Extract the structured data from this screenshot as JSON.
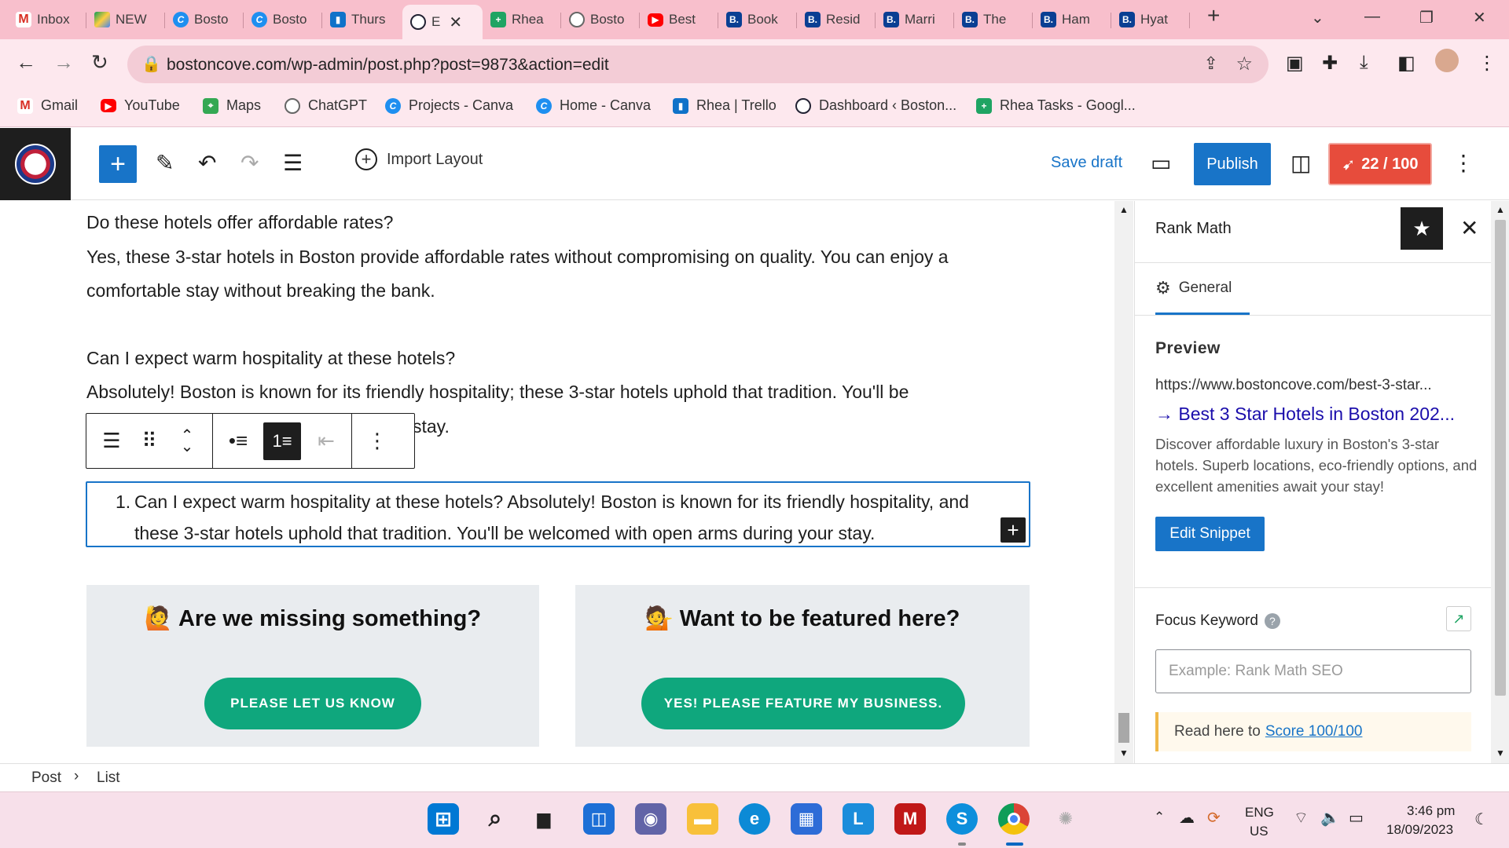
{
  "browser": {
    "tabs": [
      {
        "icon": "gmail-icon",
        "label": "Inbox"
      },
      {
        "icon": "drive-icon",
        "label": "NEW"
      },
      {
        "icon": "canva-icon",
        "label": "Bosto"
      },
      {
        "icon": "canva-icon",
        "label": "Bosto"
      },
      {
        "icon": "trello-icon",
        "label": "Thurs"
      },
      {
        "icon": "bostoncove-icon",
        "label": "E"
      },
      {
        "icon": "sheets-icon",
        "label": "Rhea"
      },
      {
        "icon": "chatgpt-icon",
        "label": "Bosto"
      },
      {
        "icon": "youtube-icon",
        "label": "Best"
      },
      {
        "icon": "booking-icon",
        "label": "Book"
      },
      {
        "icon": "booking-icon",
        "label": "Resid"
      },
      {
        "icon": "booking-icon",
        "label": "Marri"
      },
      {
        "icon": "booking-icon",
        "label": "The"
      },
      {
        "icon": "booking-icon",
        "label": "Ham"
      },
      {
        "icon": "booking-icon",
        "label": "Hyat"
      }
    ],
    "url": "bostoncove.com/wp-admin/post.php?post=9873&action=edit",
    "bookmarks": [
      {
        "icon": "gmail-icon",
        "label": "Gmail"
      },
      {
        "icon": "youtube-icon",
        "label": "YouTube"
      },
      {
        "icon": "maps-icon",
        "label": "Maps"
      },
      {
        "icon": "chatgpt-icon",
        "label": "ChatGPT"
      },
      {
        "icon": "canva-icon",
        "label": "Projects - Canva"
      },
      {
        "icon": "canva-icon",
        "label": "Home - Canva"
      },
      {
        "icon": "trello-icon",
        "label": "Rhea | Trello"
      },
      {
        "icon": "bostoncove-icon",
        "label": "Dashboard ‹ Boston..."
      },
      {
        "icon": "sheets-icon",
        "label": "Rhea Tasks - Googl..."
      }
    ]
  },
  "editor_header": {
    "import_layout": "Import Layout",
    "save_draft": "Save draft",
    "publish": "Publish",
    "seo_score": "22 / 100"
  },
  "content": {
    "q1": "Do these hotels offer affordable rates?",
    "a1_line1": "Yes, these 3-star hotels in Boston provide affordable rates without compromising on quality. You can enjoy a",
    "a1_line2": "comfortable stay without breaking the bank.",
    "q2": "Can I expect warm hospitality at these hotels?",
    "a2_line1": "Absolutely! Boston is known for its friendly hospitality; these 3-star hotels uphold that tradition. You'll be",
    "a2_tail": "stay.",
    "list_number": "1.",
    "list_item": "Can I expect warm hospitality at these hotels? Absolutely! Boston is known for its friendly hospitality, and these 3-star hotels uphold that tradition. You'll be welcomed with open arms during your stay.",
    "cta_left_title": "Are we missing something?",
    "cta_left_emoji": "🙋",
    "cta_left_button": "PLEASE LET US KNOW",
    "cta_right_title": "Want to be featured here?",
    "cta_right_emoji": "💁",
    "cta_right_button": "YES! PLEASE FEATURE MY BUSINESS."
  },
  "sidebar": {
    "title": "Rank Math",
    "tab_general": "General",
    "preview_label": "Preview",
    "snippet_url": "https://www.bostoncove.com/best-3-star...",
    "snippet_title": "→ Best 3 Star Hotels in Boston 202...",
    "snippet_desc": "Discover affordable luxury in Boston's 3-star hotels. Superb locations, eco-friendly options, and excellent amenities await your stay!",
    "edit_snippet": "Edit Snippet",
    "focus_keyword_label": "Focus Keyword",
    "focus_keyword_placeholder": "Example: Rank Math SEO",
    "score_tip_prefix": "Read here to",
    "score_tip_link": "Score 100/100"
  },
  "breadcrumb": {
    "root": "Post",
    "current": "List"
  },
  "taskbar": {
    "lang_top": "ENG",
    "lang_bottom": "US",
    "time": "3:46 pm",
    "date": "18/09/2023"
  },
  "colors": {
    "wp_blue": "#1874c8",
    "cta_green": "#0fa77d",
    "score_red": "#e74c3c",
    "chrome_pink": "#f8bfcc"
  }
}
